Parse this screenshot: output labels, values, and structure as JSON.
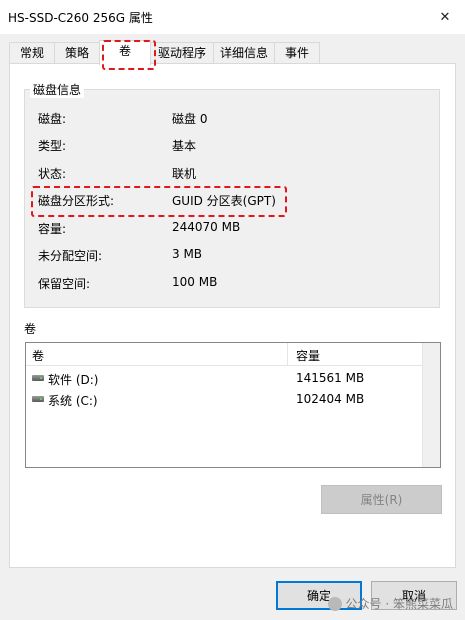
{
  "window": {
    "title": "HS-SSD-C260 256G 属性",
    "close_glyph": "✕"
  },
  "tabs": [
    {
      "label": "常规"
    },
    {
      "label": "策略"
    },
    {
      "label": "卷",
      "active": true
    },
    {
      "label": "驱动程序"
    },
    {
      "label": "详细信息"
    },
    {
      "label": "事件"
    }
  ],
  "disk_info": {
    "group_label": "磁盘信息",
    "rows": [
      {
        "label": "磁盘:",
        "value": "磁盘 0"
      },
      {
        "label": "类型:",
        "value": "基本"
      },
      {
        "label": "状态:",
        "value": "联机"
      },
      {
        "label": "磁盘分区形式:",
        "value": "GUID 分区表(GPT)",
        "highlighted": true
      },
      {
        "label": "容量:",
        "value": "244070 MB"
      },
      {
        "label": "未分配空间:",
        "value": "3 MB"
      },
      {
        "label": "保留空间:",
        "value": "100 MB"
      }
    ]
  },
  "volumes": {
    "section_label": "卷",
    "columns": [
      "卷",
      "容量"
    ],
    "rows": [
      {
        "name": "软件 (D:)",
        "capacity": "141561 MB"
      },
      {
        "name": "系统 (C:)",
        "capacity": "102404 MB"
      }
    ]
  },
  "buttons": {
    "properties": "属性(R)",
    "ok": "确定",
    "cancel": "取消"
  },
  "watermark": "公众号 · 笨熊菜菜瓜",
  "colors": {
    "annotation": "#e0181c",
    "focus_border": "#0078d7"
  }
}
